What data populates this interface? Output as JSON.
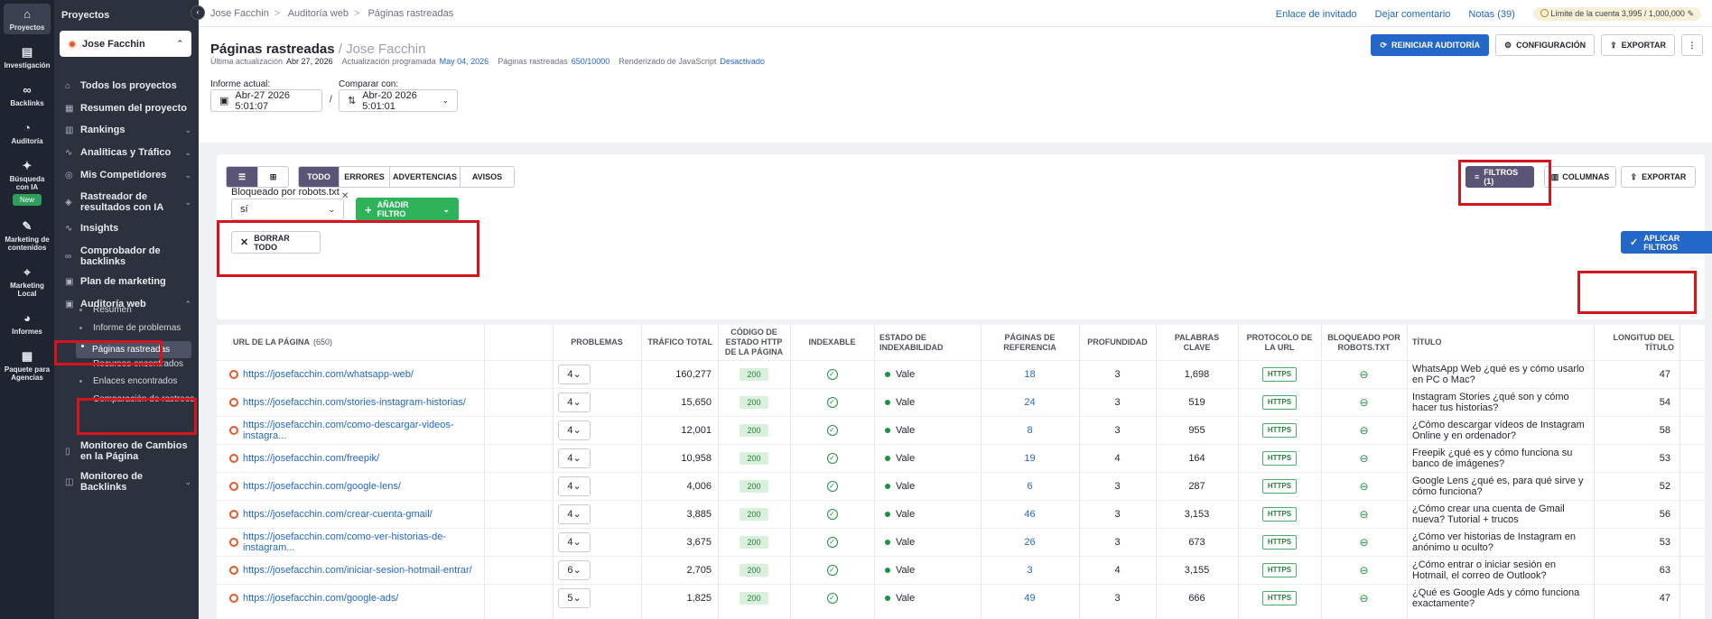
{
  "rail": [
    {
      "label": "Proyectos",
      "icon": "home-icon",
      "active": true
    },
    {
      "label": "Investigación",
      "icon": "research-icon"
    },
    {
      "label": "Backlinks",
      "icon": "link-icon"
    },
    {
      "label": "Auditoría",
      "icon": "audit-icon"
    },
    {
      "label": "Búsqueda con IA",
      "icon": "ai-sparkle-icon",
      "badge": "New"
    },
    {
      "label": "Marketing de contenidos",
      "icon": "edit-icon"
    },
    {
      "label": "Marketing Local",
      "icon": "pin-icon"
    },
    {
      "label": "Informes",
      "icon": "pie-chart-icon"
    },
    {
      "label": "Paquete para Agencias",
      "icon": "document-icon"
    }
  ],
  "sidebar": {
    "heading": "Proyectos",
    "project": "Jose Facchin",
    "items": [
      {
        "label": "Todos los proyectos",
        "icon": "home-icon"
      },
      {
        "label": "Resumen del proyecto",
        "icon": "grid-icon"
      },
      {
        "label": "Rankings",
        "icon": "bar-chart-icon",
        "chev": "⌄"
      },
      {
        "label": "Analíticas y Tráfico",
        "icon": "trend-icon",
        "chev": "⌄"
      },
      {
        "label": "Mis Competidores",
        "icon": "users-icon",
        "chev": "⌄"
      },
      {
        "label": "Rastreador de resultados con IA",
        "icon": "ai-icon",
        "chev": "⌄"
      },
      {
        "label": "Insights",
        "icon": "insights-icon"
      },
      {
        "label": "Comprobador de backlinks",
        "icon": "link-icon"
      },
      {
        "label": "Plan de marketing",
        "icon": "calendar-icon"
      },
      {
        "label": "Auditoría web",
        "icon": "audit-icon",
        "chev": "⌃"
      },
      {
        "label": "Monitoreo de Cambios en la Página",
        "icon": "monitor-icon"
      },
      {
        "label": "Monitoreo de Backlinks",
        "icon": "backlink-monitor-icon",
        "chev": "⌄"
      }
    ],
    "subitems": [
      "Resumen",
      "Informe de problemas",
      "Páginas rastreadas",
      "Recursos encontrados",
      "Enlaces encontrados",
      "Comparación de rastreos"
    ]
  },
  "breadcrumb": [
    "Jose Facchin",
    "Auditoría web",
    "Páginas rastreadas"
  ],
  "toplinks": [
    "Enlace de invitado",
    "Dejar comentario",
    "Notas (39)"
  ],
  "limit": {
    "label": "Límite de la cuenta",
    "value": "3,995 / 1,000,000"
  },
  "page": {
    "title": "Páginas rastreadas",
    "subtitle": "/ Jose Facchin",
    "meta": [
      {
        "label": "Última actualización",
        "value": "Abr 27, 2026",
        "style": "v"
      },
      {
        "label": "Actualización programada",
        "value": "May 04, 2026",
        "style": "l"
      },
      {
        "label": "Páginas rastreadas",
        "value": "650/10000",
        "style": "l"
      },
      {
        "label": "Renderizado de JavaScript",
        "value": "Desactivado",
        "style": "l"
      }
    ],
    "buttons": {
      "restart": "REINICIAR AUDITORÍA",
      "config": "CONFIGURACIÓN",
      "export": "EXPORTAR"
    },
    "current_label": "Informe actual:",
    "current_value": "Abr-27 2026 5:01:07",
    "separator": "/",
    "compare_label": "Comparar con:",
    "compare_value": "Abr-20 2026 5:01:01"
  },
  "toolbar": {
    "tabs": [
      "TODO",
      "ERRORES",
      "ADVERTENCIAS",
      "AVISOS"
    ],
    "filters": "FILTROS (1)",
    "columns": "COLUMNAS",
    "export": "EXPORTAR"
  },
  "filter": {
    "label": "Bloqueado por robots.txt",
    "value": "sí",
    "add": "AÑADIR FILTRO",
    "clear": "BORRAR TODO",
    "apply": "APLICAR FILTROS"
  },
  "table": {
    "headers": {
      "url": "URL DE LA PÁGINA",
      "count": "(650)",
      "problems": "PROBLEMAS",
      "traffic": "TRÁFICO TOTAL",
      "status": "CÓDIGO DE ESTADO HTTP DE LA PÁGINA",
      "indexable": "INDEXABLE",
      "index_state": "ESTADO DE INDEXABILIDAD",
      "refpages": "PÁGINAS DE REFERENCIA",
      "depth": "PROFUNDIDAD",
      "keywords": "PALABRAS CLAVE",
      "protocol": "PROTOCOLO DE LA URL",
      "robots": "BLOQUEADO POR ROBOTS.TXT",
      "title": "TÍTULO",
      "title_len": "LONGITUD DEL TÍTULO"
    },
    "rows": [
      {
        "url": "https://josefacchin.com/whatsapp-web/",
        "problems": "4",
        "traffic": "160,277",
        "status": "200",
        "state": "Vale",
        "refs": "18",
        "depth": "3",
        "keywords": "1,698",
        "protocol": "HTTPS",
        "title": "WhatsApp Web ¿qué es y cómo usarlo en PC o Mac?",
        "len": "47"
      },
      {
        "url": "https://josefacchin.com/stories-instagram-historias/",
        "problems": "4",
        "traffic": "15,650",
        "status": "200",
        "state": "Vale",
        "refs": "24",
        "depth": "3",
        "keywords": "519",
        "protocol": "HTTPS",
        "title": "Instagram Stories ¿qué son y cómo hacer tus historias?",
        "len": "54"
      },
      {
        "url": "https://josefacchin.com/como-descargar-videos-instagra...",
        "problems": "4",
        "traffic": "12,001",
        "status": "200",
        "state": "Vale",
        "refs": "8",
        "depth": "3",
        "keywords": "955",
        "protocol": "HTTPS",
        "title": "¿Cómo descargar vídeos de Instagram Online y en ordenador?",
        "len": "58"
      },
      {
        "url": "https://josefacchin.com/freepik/",
        "problems": "4",
        "traffic": "10,958",
        "status": "200",
        "state": "Vale",
        "refs": "19",
        "depth": "4",
        "keywords": "164",
        "protocol": "HTTPS",
        "title": "Freepik ¿qué es y cómo funciona su banco de imágenes?",
        "len": "53"
      },
      {
        "url": "https://josefacchin.com/google-lens/",
        "problems": "4",
        "traffic": "4,006",
        "status": "200",
        "state": "Vale",
        "refs": "6",
        "depth": "3",
        "keywords": "287",
        "protocol": "HTTPS",
        "title": "Google Lens ¿qué es, para qué sirve y cómo funciona?",
        "len": "52"
      },
      {
        "url": "https://josefacchin.com/crear-cuenta-gmail/",
        "problems": "4",
        "traffic": "3,885",
        "status": "200",
        "state": "Vale",
        "refs": "46",
        "depth": "3",
        "keywords": "3,153",
        "protocol": "HTTPS",
        "title": "¿Cómo crear una cuenta de Gmail nueva? Tutorial + trucos",
        "len": "56"
      },
      {
        "url": "https://josefacchin.com/como-ver-historias-de-instagram...",
        "problems": "4",
        "traffic": "3,675",
        "status": "200",
        "state": "Vale",
        "refs": "26",
        "depth": "3",
        "keywords": "673",
        "protocol": "HTTPS",
        "title": "¿Cómo ver historias de Instagram en anónimo u oculto?",
        "len": "53"
      },
      {
        "url": "https://josefacchin.com/iniciar-sesion-hotmail-entrar/",
        "problems": "6",
        "traffic": "2,705",
        "status": "200",
        "state": "Vale",
        "refs": "3",
        "depth": "4",
        "keywords": "3,155",
        "protocol": "HTTPS",
        "title": "¿Cómo entrar o iniciar sesión en Hotmail, el correo de Outlook?",
        "len": "63"
      },
      {
        "url": "https://josefacchin.com/google-ads/",
        "problems": "5",
        "traffic": "1,825",
        "status": "200",
        "state": "Vale",
        "refs": "49",
        "depth": "3",
        "keywords": "666",
        "protocol": "HTTPS",
        "title": "¿Qué es Google Ads y cómo funciona exactamente?",
        "len": "47"
      }
    ]
  }
}
